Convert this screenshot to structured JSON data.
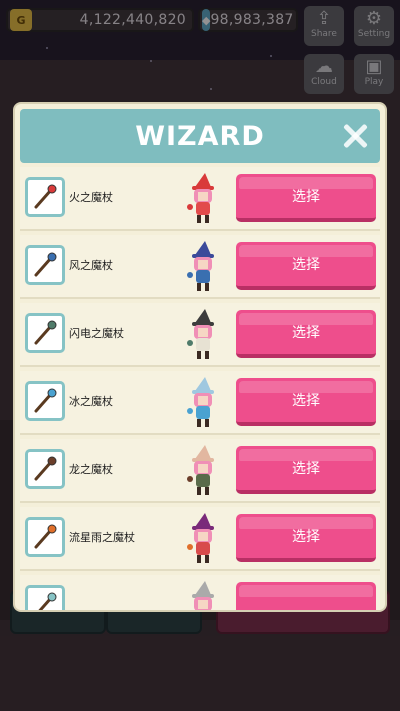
{
  "top_bar": {
    "coins_icon_label": "G",
    "coins_value": "4,122,440,820",
    "gems_value": "98,983,387",
    "share_label": "Share",
    "settings_label": "Setting",
    "cloud_label": "Cloud",
    "play_label": "Play"
  },
  "modal": {
    "title": "WIZARD",
    "items": [
      {
        "name": "火之魔杖",
        "button": "选择",
        "staff_color": "#d93a3a",
        "hat_color": "#d93a3a",
        "hair_color": "#f08fb6",
        "robe_color": "#e24b4b"
      },
      {
        "name": "风之魔杖",
        "button": "选择",
        "staff_color": "#3a6fb0",
        "hat_color": "#3b4a9a",
        "hair_color": "#f08fb6",
        "robe_color": "#3a6fb0"
      },
      {
        "name": "闪电之魔杖",
        "button": "选择",
        "staff_color": "#4f7b6a",
        "hat_color": "#3d3d3d",
        "hair_color": "#f08fb6",
        "robe_color": "#e7e2d3"
      },
      {
        "name": "冰之魔杖",
        "button": "选择",
        "staff_color": "#4aa2d1",
        "hat_color": "#9fc8e0",
        "hair_color": "#f08fb6",
        "robe_color": "#4aa2d1"
      },
      {
        "name": "龙之魔杖",
        "button": "选择",
        "staff_color": "#6b3e2a",
        "hat_color": "#e2b7a0",
        "hair_color": "#f08fb6",
        "robe_color": "#5a6b4a"
      },
      {
        "name": "流星雨之魔杖",
        "button": "选择",
        "staff_color": "#e06f2a",
        "hat_color": "#7a2a7a",
        "hair_color": "#f08fb6",
        "robe_color": "#d84b4b"
      },
      {
        "name": "",
        "button": "",
        "staff_color": "#86c3c5",
        "hat_color": "#aaaaaa",
        "hair_color": "#f08fb6",
        "robe_color": "#cccccc"
      }
    ]
  }
}
